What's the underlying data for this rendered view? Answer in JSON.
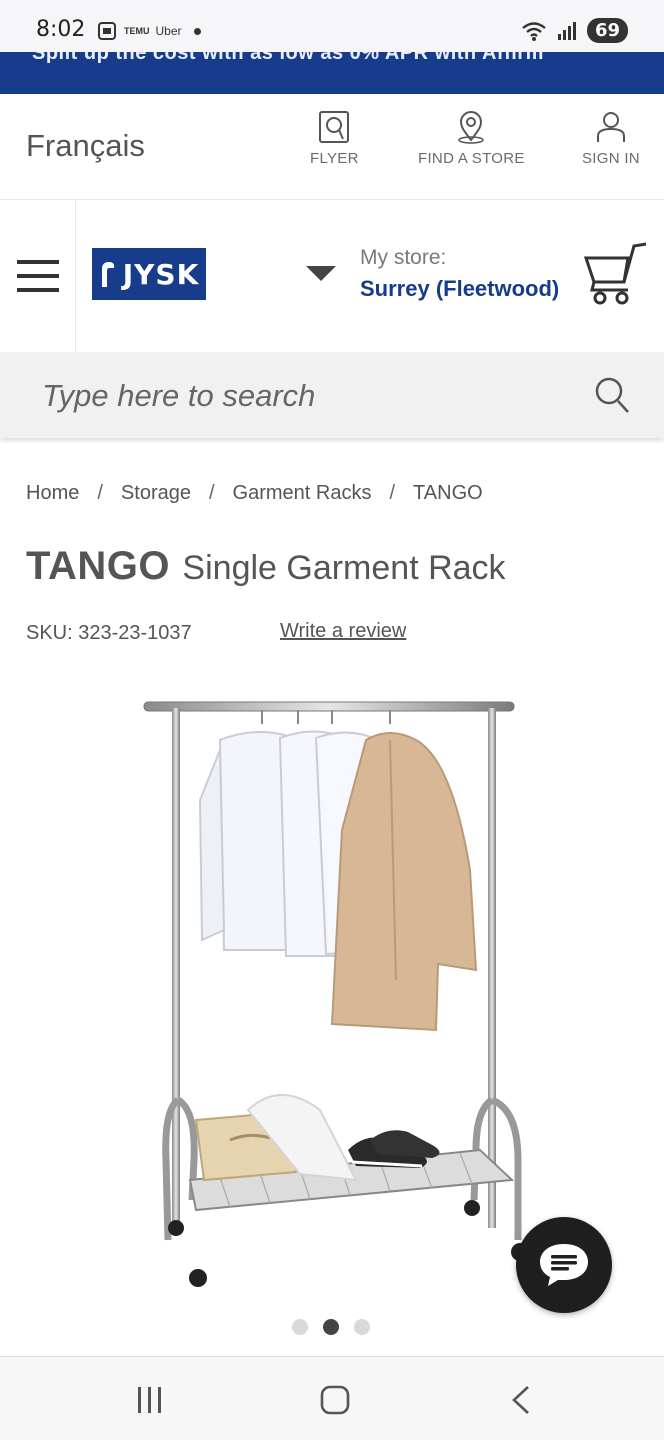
{
  "status_bar": {
    "time": "8:02",
    "left_icons": [
      "screenshot-icon",
      "temu-icon",
      "uber-icon",
      "dot-icon"
    ],
    "notif_text_1": "TEMU",
    "notif_text_2": "Uber",
    "battery": "69"
  },
  "promo": {
    "text": "Split up the cost with as low as 0% APR with Affirm"
  },
  "utility": {
    "language": "Français",
    "flyer": "FLYER",
    "find_store": "FIND A STORE",
    "sign_in": "SIGN IN"
  },
  "header": {
    "logo_text": "JYSK",
    "store_label": "My store:",
    "store_name": "Surrey (Fleetwood)"
  },
  "search": {
    "placeholder": "Type here to search"
  },
  "breadcrumb": [
    "Home",
    "Storage",
    "Garment Racks",
    "TANGO"
  ],
  "product": {
    "brand": "TANGO",
    "name": "Single Garment Rack",
    "sku": "SKU: 323-23-1037",
    "write_review": "Write a review"
  },
  "carousel": {
    "count": 3,
    "active": 1
  },
  "colors": {
    "brand_blue": "#183c8c",
    "dark": "#1f1f1f"
  }
}
